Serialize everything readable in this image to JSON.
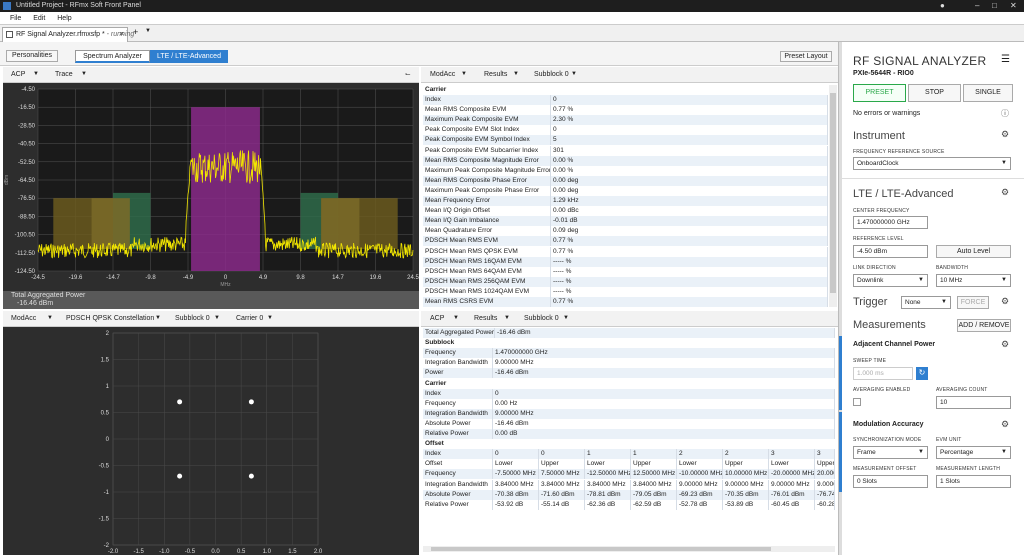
{
  "window": {
    "title": "Untitled Project - RFmx Soft Front Panel"
  },
  "menu": [
    "File",
    "Edit",
    "Help"
  ],
  "doc_tab": {
    "label": "RF Signal Analyzer.rfmxsfp *",
    "status": "- running",
    "add": "+"
  },
  "toolbar": {
    "personalities": "Personalities",
    "spectrum": "Spectrum Analyzer",
    "lte": "LTE / LTE-Advanced",
    "preset_layout": "Preset Layout"
  },
  "spectrum_panel": {
    "measurement": "ACP",
    "view": "Trace",
    "y_ticks": [
      "-4.50",
      "-16.50",
      "-28.50",
      "-40.50",
      "-52.50",
      "-64.50",
      "-76.50",
      "-88.50",
      "-100.50",
      "-112.50",
      "-124.50"
    ],
    "x_ticks": [
      "-24.5",
      "-19.6",
      "-14.7",
      "-9.8",
      "-4.9",
      "0",
      "4.9",
      "9.8",
      "14.7",
      "19.6",
      "24.5"
    ],
    "y_unit": "dBm",
    "x_unit": "MHz",
    "footer_label": "Total Aggregated Power",
    "footer_value": "-16.46 dBm"
  },
  "modacc_panel": {
    "measurement": "ModAcc",
    "view": "Results",
    "subblock": "Subblock 0",
    "section": "Carrier",
    "rows": [
      [
        "Index",
        "0"
      ],
      [
        "Mean RMS Composite EVM",
        "0.77 %"
      ],
      [
        "Maximum Peak Composite EVM",
        "2.30 %"
      ],
      [
        "Peak Composite EVM Slot Index",
        "0"
      ],
      [
        "Peak Composite EVM Symbol Index",
        "5"
      ],
      [
        "Peak Composite EVM Subcarrier Index",
        "301"
      ],
      [
        "Mean RMS Composite Magnitude Error",
        "0.00 %"
      ],
      [
        "Maximum Peak Composite Magnitude Error",
        "0.00 %"
      ],
      [
        "Mean RMS Composite Phase Error",
        "0.00 deg"
      ],
      [
        "Maximum Peak Composite Phase Error",
        "0.00 deg"
      ],
      [
        "Mean Frequency Error",
        "1.29 kHz"
      ],
      [
        "Mean I/Q Origin Offset",
        "0.00 dBc"
      ],
      [
        "Mean I/Q Gain Imbalance",
        "-0.01 dB"
      ],
      [
        "Mean Quadrature Error",
        "0.09 deg"
      ],
      [
        "PDSCH Mean RMS EVM",
        "0.77 %"
      ],
      [
        "PDSCH Mean RMS QPSK EVM",
        "0.77 %"
      ],
      [
        "PDSCH Mean RMS 16QAM EVM",
        "----- %"
      ],
      [
        "PDSCH Mean RMS 64QAM EVM",
        "----- %"
      ],
      [
        "PDSCH Mean RMS 256QAM EVM",
        "----- %"
      ],
      [
        "PDSCH Mean RMS 1024QAM EVM",
        "----- %"
      ],
      [
        "Mean RMS CSRS EVM",
        "0.77 %"
      ]
    ]
  },
  "constellation_panel": {
    "measurement": "ModAcc",
    "view": "PDSCH QPSK Constellation",
    "subblock": "Subblock 0",
    "carrier": "Carrier 0",
    "y_ticks": [
      "2",
      "1.5",
      "1",
      "0.5",
      "0",
      "-0.5",
      "-1",
      "-1.5",
      "-2"
    ],
    "x_ticks": [
      "-2.0",
      "-1.5",
      "-1.0",
      "-0.5",
      "0.0",
      "0.5",
      "1.0",
      "1.5",
      "2.0"
    ],
    "points": [
      [
        -0.7,
        0.7
      ],
      [
        0.7,
        0.7
      ],
      [
        -0.7,
        -0.7
      ],
      [
        0.7,
        -0.7
      ]
    ]
  },
  "acp_panel": {
    "measurement": "ACP",
    "view": "Results",
    "subblock": "Subblock 0",
    "total_label": "Total Aggregated Power",
    "total_value": "-16.46 dBm",
    "subblock_section": "Subblock",
    "subblock_rows": [
      [
        "Frequency",
        "1.470000000 GHz"
      ],
      [
        "Integration Bandwidth",
        "9.00000 MHz"
      ],
      [
        "Power",
        "-16.46 dBm"
      ]
    ],
    "carrier_section": "Carrier",
    "carrier_rows": [
      [
        "Index",
        "0"
      ],
      [
        "Frequency",
        "0.00 Hz"
      ],
      [
        "Integration Bandwidth",
        "9.00000 MHz"
      ],
      [
        "Absolute Power",
        "-16.46 dBm"
      ],
      [
        "Relative Power",
        "0.00 dB"
      ]
    ],
    "offset_section": "Offset",
    "offset_rows": [
      [
        "Index",
        "0",
        "0",
        "1",
        "1",
        "2",
        "2",
        "3",
        "3"
      ],
      [
        "Offset",
        "Lower",
        "Upper",
        "Lower",
        "Upper",
        "Lower",
        "Upper",
        "Lower",
        "Upper"
      ],
      [
        "Frequency",
        "-7.50000 MHz",
        "7.50000 MHz",
        "-12.50000 MHz",
        "12.50000 MHz",
        "-10.00000 MHz",
        "10.00000 MHz",
        "-20.00000 MHz",
        "20.0000"
      ],
      [
        "Integration Bandwidth",
        "3.84000 MHz",
        "3.84000 MHz",
        "3.84000 MHz",
        "3.84000 MHz",
        "9.00000 MHz",
        "9.00000 MHz",
        "9.00000 MHz",
        "9.00000"
      ],
      [
        "Absolute Power",
        "-70.38 dBm",
        "-71.60 dBm",
        "-78.81 dBm",
        "-79.05 dBm",
        "-69.23 dBm",
        "-70.35 dBm",
        "-76.01 dBm",
        "-76.74 d"
      ],
      [
        "Relative Power",
        "-53.92 dB",
        "-55.14 dB",
        "-62.36 dB",
        "-62.59 dB",
        "-52.78 dB",
        "-53.89 dB",
        "-60.45 dB",
        "-60.28 d"
      ]
    ]
  },
  "right_panel": {
    "title": "RF SIGNAL ANALYZER",
    "device": "PXIe-5644R",
    "resource": "RIO0",
    "preset": "PRESET",
    "stop": "STOP",
    "single": "SINGLE",
    "status": "No errors or warnings",
    "instrument": "Instrument",
    "freq_ref_label": "FREQUENCY REFERENCE SOURCE",
    "freq_ref_value": "OnboardClock",
    "lte": "LTE / LTE-Advanced",
    "center_freq_label": "CENTER FREQUENCY",
    "center_freq_value": "1.470000000 GHz",
    "ref_level_label": "REFERENCE LEVEL",
    "ref_level_value": "-4.50 dBm",
    "auto_level": "Auto Level",
    "link_dir_label": "LINK DIRECTION",
    "link_dir_value": "Downlink",
    "bandwidth_label": "BANDWIDTH",
    "bandwidth_value": "10 MHz",
    "trigger": "Trigger",
    "trigger_value": "None",
    "force": "FORCE",
    "measurements": "Measurements",
    "add_remove": "ADD / REMOVE",
    "acp_title": "Adjacent Channel Power",
    "sweep_label": "SWEEP TIME",
    "sweep_value": "1.000 ms",
    "avg_enabled_label": "AVERAGING ENABLED",
    "avg_count_label": "AVERAGING COUNT",
    "avg_count_value": "10",
    "modacc_title": "Modulation Accuracy",
    "sync_label": "SYNCHRONIZATION MODE",
    "sync_value": "Frame",
    "evm_unit_label": "EVM UNIT",
    "evm_unit_value": "Percentage",
    "offset_label": "MEASUREMENT OFFSET",
    "offset_value": "0 Slots",
    "length_label": "MEASUREMENT LENGTH",
    "length_value": "1 Slots"
  },
  "colors": {
    "trace": "#f2e600",
    "accent": "#2f7fd0",
    "preset_green": "#2aa84a",
    "carrier_band": "#8a2a8a"
  }
}
